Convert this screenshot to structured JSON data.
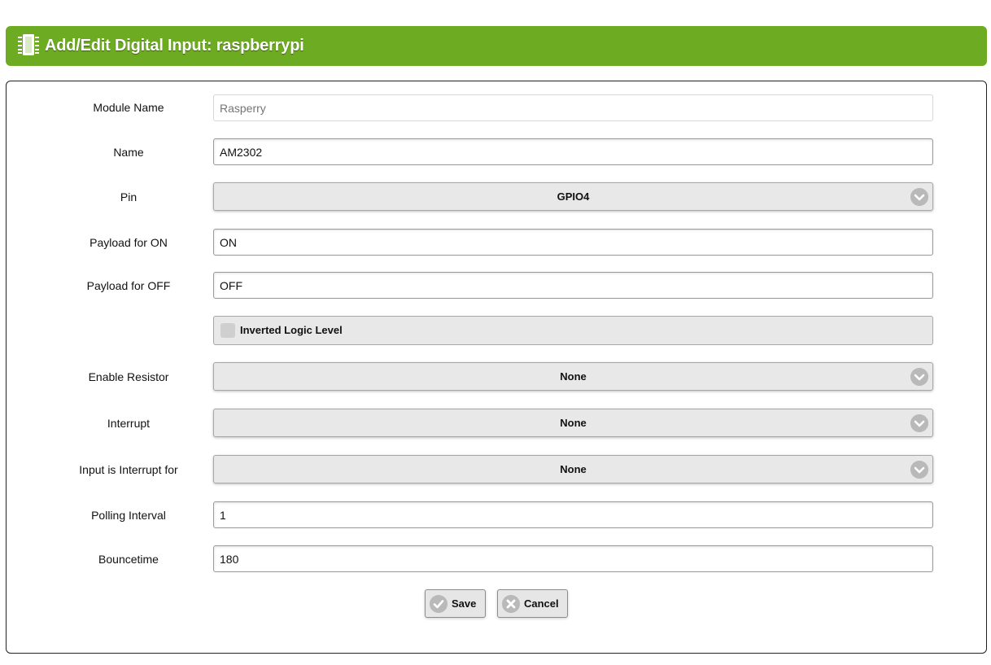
{
  "header": {
    "title": "Add/Edit Digital Input: raspberrypi",
    "icon": "chip-icon",
    "background_color": "#6dab22"
  },
  "form": {
    "module_name": {
      "label": "Module Name",
      "placeholder": "Rasperry",
      "value": ""
    },
    "name": {
      "label": "Name",
      "value": "AM2302"
    },
    "pin": {
      "label": "Pin",
      "selected": "GPIO4"
    },
    "payload_on": {
      "label": "Payload for ON",
      "value": "ON"
    },
    "payload_off": {
      "label": "Payload for OFF",
      "value": "OFF"
    },
    "inverted_logic": {
      "label": "Inverted Logic Level",
      "checked": false
    },
    "enable_resistor": {
      "label": "Enable Resistor",
      "selected": "None"
    },
    "interrupt": {
      "label": "Interrupt",
      "selected": "None"
    },
    "input_interrupt_for": {
      "label": "Input is Interrupt for",
      "selected": "None"
    },
    "polling_interval": {
      "label": "Polling Interval",
      "value": "1"
    },
    "bouncetime": {
      "label": "Bouncetime",
      "value": "180"
    }
  },
  "buttons": {
    "save_label": "Save",
    "cancel_label": "Cancel"
  }
}
